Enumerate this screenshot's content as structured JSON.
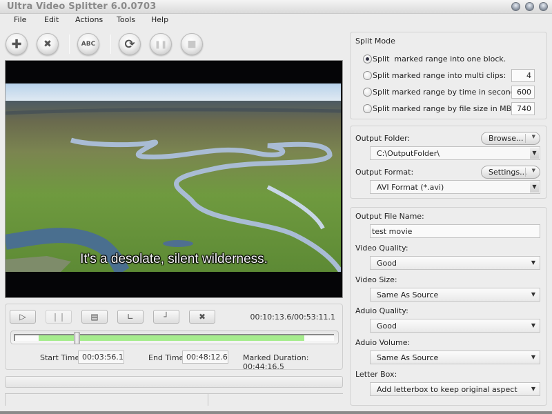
{
  "window": {
    "title": "Ultra Video Splitter 6.0.0703",
    "controls": [
      "minimize-button",
      "maximize-button",
      "close-button"
    ]
  },
  "menu": {
    "items": [
      {
        "label": "File"
      },
      {
        "label": "Edit"
      },
      {
        "label": "Actions"
      },
      {
        "label": "Tools"
      },
      {
        "label": "Help"
      }
    ]
  },
  "toolbar": {
    "buttons": [
      {
        "name": "add",
        "icon": "plus-icon",
        "glyph": "✚",
        "enabled": true
      },
      {
        "name": "remove",
        "icon": "x-icon",
        "glyph": "✖",
        "enabled": true
      },
      {
        "name": "rename",
        "icon": "abc-icon",
        "glyph": "ABC",
        "enabled": true
      },
      {
        "name": "convert",
        "icon": "refresh-icon",
        "glyph": "⟳",
        "enabled": true
      },
      {
        "name": "pause",
        "icon": "pause-icon",
        "glyph": "❚❚",
        "enabled": false
      },
      {
        "name": "stop",
        "icon": "stop-icon",
        "glyph": "■",
        "enabled": false
      }
    ]
  },
  "video": {
    "subtitle": "It's a desolate, silent wilderness."
  },
  "player": {
    "buttons": [
      {
        "name": "play",
        "icon": "play-icon",
        "glyph": "▷",
        "enabled": true
      },
      {
        "name": "pause",
        "icon": "pause-icon",
        "glyph": "❙❙",
        "enabled": false
      },
      {
        "name": "snapshot",
        "icon": "frame-icon",
        "glyph": "▤",
        "enabled": true
      },
      {
        "name": "mark-start",
        "icon": "mark-start-icon",
        "glyph": "∟",
        "enabled": true
      },
      {
        "name": "mark-end",
        "icon": "mark-end-icon",
        "glyph": "┘",
        "enabled": true
      },
      {
        "name": "clear-marks",
        "icon": "clear-icon",
        "glyph": "✖",
        "enabled": true
      }
    ],
    "time_readout": "00:10:13.6/00:53:11.1",
    "position_fraction": 0.192,
    "range_start_fraction": 0.074,
    "range_end_fraction": 0.906,
    "start_time_label": "Start Time:",
    "start_time": "00:03:56.1",
    "end_time_label": "End Time:",
    "end_time": "00:48:12.6",
    "marked_duration_label": "Marked Duration:",
    "marked_duration": "00:44:16.5"
  },
  "split_mode": {
    "title": "Split Mode",
    "options": [
      {
        "label": "Split  marked range into one block.",
        "checked": true,
        "value": null
      },
      {
        "label": "Split marked range into multi clips:",
        "checked": false,
        "value": "4"
      },
      {
        "label": "Split marked range by time in seconds:",
        "checked": false,
        "value": "600"
      },
      {
        "label": "Split marked range by file size in MB:",
        "checked": false,
        "value": "740"
      }
    ]
  },
  "output": {
    "folder_label": "Output Folder:",
    "browse_label": "Browse...",
    "folder_value": "C:\\OutputFolder\\",
    "format_label": "Output Format:",
    "settings_label": "Settings...",
    "format_value": "AVI Format (*.avi)"
  },
  "options": {
    "file_name_label": "Output File Name:",
    "file_name_value": "test movie",
    "video_quality_label": "Video Quality:",
    "video_quality_value": "Good",
    "video_size_label": "Video Size:",
    "video_size_value": "Same As Source",
    "audio_quality_label": "Aduio Quality:",
    "audio_quality_value": "Good",
    "audio_volume_label": "Aduio Volume:",
    "audio_volume_value": "Same As Source",
    "letterbox_label": "Letter Box:",
    "letterbox_value": "Add letterbox to keep original aspect"
  },
  "colors": {
    "range_green": "#a6ec8d",
    "background": "#ececec"
  }
}
